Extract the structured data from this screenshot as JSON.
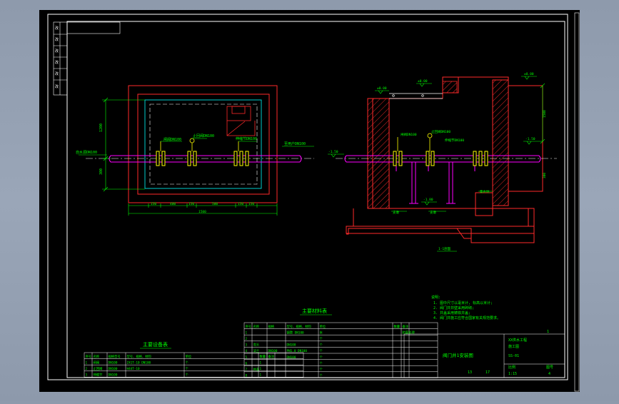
{
  "colors": {
    "background": "#9aa6b8",
    "sheet": "#000000",
    "frame": "#ffffff",
    "wall": "#ff0000",
    "cyan": "#00ffff",
    "pipe": "#ff00ff",
    "dimension": "#00ff00",
    "flange": "#ffff00",
    "text": "#00ff00"
  },
  "drawing": {
    "plan_title": "",
    "section_title": "1-1剖面",
    "section_title_short": "1-1 剖面",
    "plan_dims": {
      "bottom_segments": [
        "150",
        "400",
        "150",
        "500",
        "150",
        "150"
      ],
      "bottom_total": "1500",
      "left_height": "1200",
      "left_small": "300"
    },
    "plan_labels": {
      "inlet": "自水源DN100",
      "outlet": "至用户DN100",
      "valve1": "闸阀DN100",
      "valve2": "止回阀DN100",
      "valve3": "伸缩节DN100"
    },
    "section_labels": {
      "level_top_left": "±0.00",
      "level_top_mid": "±0.00",
      "level_top_right": "±0.00",
      "level_pipe_left": "-1.50",
      "level_pipe_right": "-1.50",
      "level_bottom": "-1.80",
      "inlet": "-1.50",
      "valve1": "闸阀DN100",
      "valve2": "止回阀DN100",
      "valve3": "伸缩节DN100",
      "support1": "支墩",
      "support2": "支墩",
      "sump": "集水坑",
      "right_height": "1500",
      "right_small": "300"
    },
    "notes": {
      "title": "说明:",
      "lines": [
        "1. 图中尺寸以毫米计, 标高以米计;",
        "2. 阀门井井壁采用砖砌;",
        "3. 井盖采用铸铁井盖;",
        "4. 阀门井施工应符合国家有关规范要求。"
      ]
    },
    "equipment_table": {
      "title": "主要设备表",
      "headers": [
        "序号",
        "名称",
        "规格型号",
        "型号、规格、材料",
        "单位",
        "数量",
        "备注"
      ],
      "rows": [
        [
          "1",
          "闸阀",
          "DN100",
          "Z41T-10 DN100",
          "个",
          "1",
          ""
        ],
        [
          "2",
          "止回阀",
          "DN100",
          "H44T-10",
          "个",
          "1",
          ""
        ],
        [
          "3",
          "伸缩节",
          "DN100",
          "",
          "个",
          "1",
          ""
        ]
      ]
    },
    "material_table": {
      "title": "主要材料表",
      "headers": [
        "序号",
        "名称",
        "规格",
        "型号、规格、材料",
        "单位",
        "数量",
        "备注"
      ],
      "rows": [
        [
          "1",
          "",
          "",
          "钢管 DN100",
          "米",
          "",
          "防腐处理"
        ],
        [
          "2",
          "",
          "",
          "",
          "个",
          "",
          ""
        ],
        [
          "3",
          "弯头",
          "",
          "DN100",
          "个",
          "",
          ""
        ],
        [
          "4",
          "法兰",
          "DN100",
          "PN1.0 DN100",
          "个",
          "",
          ""
        ],
        [
          "5",
          "",
          "",
          "DN100",
          "个",
          "",
          ""
        ],
        [
          "6",
          "",
          "",
          "",
          "个",
          "",
          ""
        ],
        [
          "7",
          "井盖",
          "",
          "",
          "个",
          "",
          ""
        ],
        [
          "8",
          "",
          "",
          "",
          "个",
          "",
          ""
        ]
      ]
    },
    "title_block": {
      "drawing_name": "阀门井1安装图",
      "project": "XX供水工程",
      "stage": "施工图",
      "number": "SS-01",
      "scale_label": "比例",
      "scale": "1:15",
      "sheet_label": "图号",
      "sheet": "4",
      "left_code": "13",
      "right_code": "17",
      "mark": "1"
    },
    "revision_column": [
      "",
      "",
      "",
      "",
      "",
      ""
    ]
  }
}
